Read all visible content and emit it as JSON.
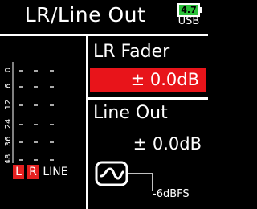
{
  "header": {
    "title": "LR/Line Out",
    "battery": {
      "level": "4.7",
      "source": "USB",
      "color": "#2cc23a"
    }
  },
  "meter": {
    "scale": [
      "0",
      "6",
      "12",
      "24",
      "36",
      "48"
    ],
    "channels": [
      {
        "label": "L",
        "highlighted": true,
        "color": "#e52020"
      },
      {
        "label": "R",
        "highlighted": true,
        "color": "#e52020"
      },
      {
        "label": "LINE",
        "highlighted": false
      }
    ]
  },
  "lr_fader": {
    "label": "LR Fader",
    "value": "± 0.0dB",
    "selected": true,
    "selected_color": "#e8141a"
  },
  "line_out": {
    "label": "Line Out",
    "value": "± 0.0dB",
    "filter_icon": "wave-filter-icon",
    "level_label": "-6dBFS"
  }
}
